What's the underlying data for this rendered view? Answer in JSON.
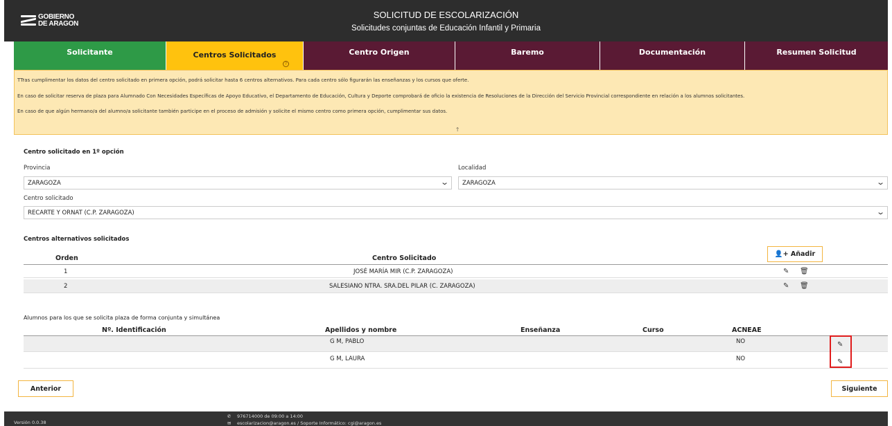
{
  "header": {
    "logo_line1": "GOBIERNO",
    "logo_line2": "DE ARAGON",
    "title": "SOLICITUD DE ESCOLARIZACIÓN",
    "subtitle": "Solicitudes conjuntas de Educación Infantil y Primaria"
  },
  "tabs": [
    {
      "label": "Solicitante"
    },
    {
      "label": "Centros Solicitados",
      "help": "?"
    },
    {
      "label": "Centro Origen"
    },
    {
      "label": "Baremo"
    },
    {
      "label": "Documentación"
    },
    {
      "label": "Resumen Solicitud"
    }
  ],
  "info": {
    "p1": "TTras cumplimentar los datos del centro solicitado en primera opción, podrá solicitar hasta 6 centros alternativos. Para cada centro sólo figurarán las enseñanzas y los cursos que oferte.",
    "p2": "En caso de solicitar reserva de plaza para Alumnado Con Necesidades Específicas de Apoyo Educativo, el Departamento de Educación, Cultura y Deporte comprobará de oficio la existencia de Resoluciones de la Dirección del Servicio Provincial correspondiente en relación a los alumnos solicitantes.",
    "p3": "En caso de que algún hermano/a del alumno/a solicitante también participe en el proceso de admisión y solicite el mismo centro como primera opción, cumplimentar sus datos.",
    "arrow": "🡑"
  },
  "first_option": {
    "section_title": "Centro solicitado en 1º opción",
    "provincia_label": "Provincia",
    "provincia_value": "ZARAGOZA",
    "localidad_label": "Localidad",
    "localidad_value": "ZARAGOZA",
    "centro_label": "Centro solicitado",
    "centro_value": "RECARTE Y ORNAT (C.P. ZARAGOZA)"
  },
  "alternatives": {
    "section_title": "Centros alternativos solicitados",
    "add_button": "Añadir",
    "col_orden": "Orden",
    "col_centro": "Centro Solicitado",
    "rows": [
      {
        "orden": "1",
        "centro": "JOSÉ MARÍA MIR (C.P. ZARAGOZA)"
      },
      {
        "orden": "2",
        "centro": "SALESIANO NTRA. SRA.DEL PILAR (C. ZARAGOZA)"
      }
    ]
  },
  "students": {
    "section_title": "Alumnos para los que se solicita plaza de forma conjunta y simultánea",
    "col_id": "Nº. Identificación",
    "col_name": "Apellidos y nombre",
    "col_ensenanza": "Enseñanza",
    "col_curso": "Curso",
    "col_acneae": "ACNEAE",
    "rows": [
      {
        "id": "",
        "name": "G M, PABLO",
        "ensenanza": "",
        "curso": "",
        "acneae": "NO"
      },
      {
        "id": "",
        "name": "G M, LAURA",
        "ensenanza": "",
        "curso": "",
        "acneae": "NO"
      }
    ]
  },
  "nav": {
    "prev": "Anterior",
    "next": "Siguiente"
  },
  "footer": {
    "version": "Versión 0.0.38",
    "phone": "976714000 de 09:00 a 14:00",
    "email": "escolarizacion@aragon.es / Soporte Informático: cgi@aragon.es"
  },
  "colors": {
    "tab_done": "#2e9a47",
    "tab_active": "#ffc20e",
    "tab_pending": "#5a1a34",
    "info_bg": "#fde8b4",
    "highlight": "#e01b1b"
  }
}
